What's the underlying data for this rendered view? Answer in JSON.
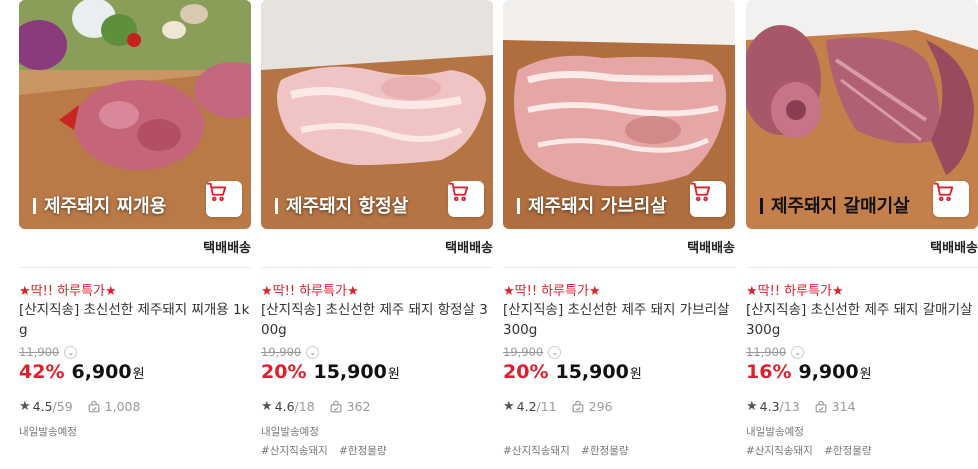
{
  "colors": {
    "accent": "#e01e2c"
  },
  "products": [
    {
      "thumb_title": "제주돼지 찌개용",
      "shipping": "택배배송",
      "promo": "★딱!! 하루특가★",
      "name": "[산지직송] 초신선한 제주돼지 찌개용 1kg",
      "original_price": "11,900",
      "discount": "42%",
      "price": "6,900",
      "currency": "원",
      "rating": "4.5",
      "reviews": "59",
      "buyers": "1,008",
      "delivery": "내일발송예정",
      "tags": []
    },
    {
      "thumb_title": "제주돼지 항정살",
      "shipping": "택배배송",
      "promo": "★딱!! 하루특가★",
      "name": "[산지직송] 초신선한 제주 돼지 항정살 300g",
      "original_price": "19,900",
      "discount": "20%",
      "price": "15,900",
      "currency": "원",
      "rating": "4.6",
      "reviews": "18",
      "buyers": "362",
      "delivery": "내일발송예정",
      "tags": [
        "#산지직송돼지",
        "#한정물량"
      ]
    },
    {
      "thumb_title": "제주돼지 가브리살",
      "shipping": "택배배송",
      "promo": "★딱!! 하루특가★",
      "name": "[산지직송] 초신선한 제주 돼지 가브리살 300g",
      "original_price": "19,900",
      "discount": "20%",
      "price": "15,900",
      "currency": "원",
      "rating": "4.2",
      "reviews": "11",
      "buyers": "296",
      "delivery": "",
      "tags": [
        "#산지직송돼지",
        "#한정물량"
      ]
    },
    {
      "thumb_title": "제주돼지 갈매기살",
      "shipping": "택배배송",
      "promo": "★딱!! 하루특가★",
      "name": "[산지직송] 초신선한 제주 돼지 갈매기살 300g",
      "original_price": "11,900",
      "discount": "16%",
      "price": "9,900",
      "currency": "원",
      "rating": "4.3",
      "reviews": "13",
      "buyers": "314",
      "delivery": "내일발송예정",
      "tags": [
        "#산지직송돼지",
        "#한정물량"
      ]
    }
  ]
}
